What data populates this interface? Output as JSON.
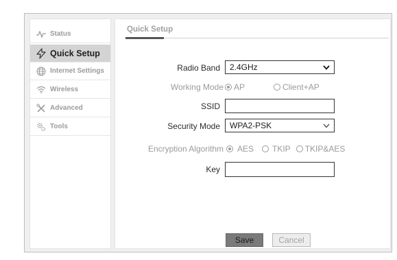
{
  "sidebar": {
    "items": [
      {
        "label": "Status",
        "icon": "status-pulse-icon",
        "active": false
      },
      {
        "label": "Quick Setup",
        "icon": "quick-setup-lightning-icon",
        "active": true
      },
      {
        "label": "Internet Settings",
        "icon": "globe-icon",
        "active": false
      },
      {
        "label": "Wireless",
        "icon": "wifi-icon",
        "active": false
      },
      {
        "label": "Advanced",
        "icon": "tools-cross-icon",
        "active": false
      },
      {
        "label": "Tools",
        "icon": "gears-icon",
        "active": false
      }
    ]
  },
  "main": {
    "tab_title": "Quick Setup",
    "radio_band": {
      "label": "Radio Band",
      "value": "2.4GHz"
    },
    "working_mode": {
      "label": "Working Mode",
      "options": [
        "AP",
        "Client+AP"
      ],
      "selected": "AP"
    },
    "ssid": {
      "label": "SSID",
      "value": ""
    },
    "security_mode": {
      "label": "Security Mode",
      "value": "WPA2-PSK"
    },
    "encryption": {
      "label": "Encryption Algorithm",
      "options": [
        "AES",
        "TKIP",
        "TKIP&AES"
      ],
      "selected": "AES"
    },
    "key": {
      "label": "Key",
      "value": ""
    },
    "buttons": {
      "save": "Save",
      "cancel": "Cancel"
    }
  },
  "colors": {
    "active_menu_bg": "#d3d3d3",
    "save_button_bg": "#7a7a7a"
  }
}
